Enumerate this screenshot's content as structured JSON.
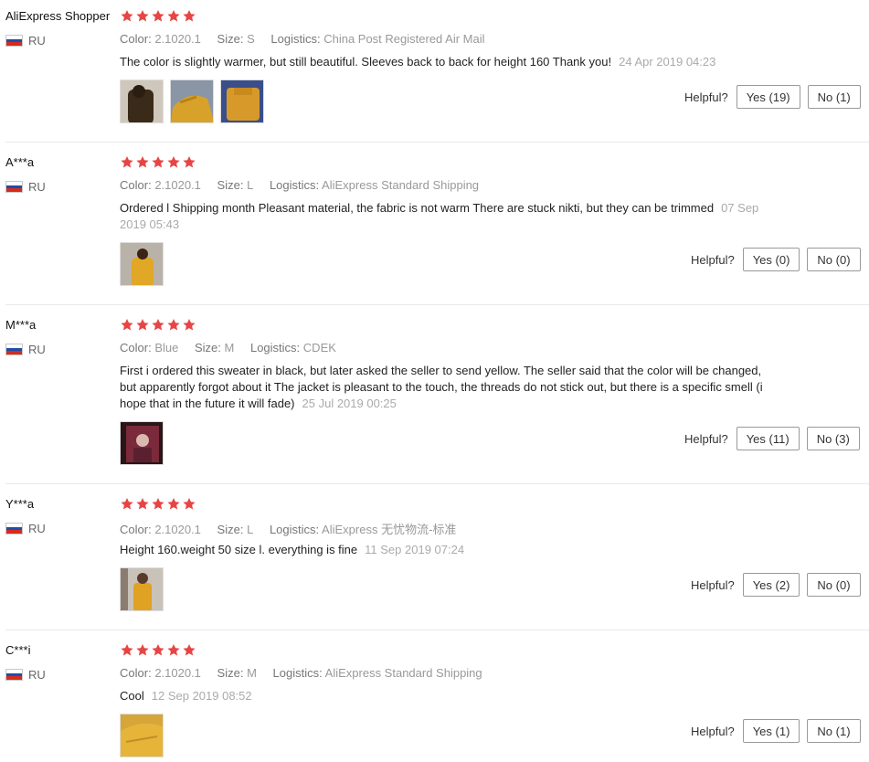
{
  "labels": {
    "color": "Color:",
    "size": "Size:",
    "logistics": "Logistics:",
    "helpful": "Helpful?"
  },
  "star_color": "#e64545",
  "reviews": [
    {
      "user": "AliExpress Shopper",
      "country": "RU",
      "rating": 5,
      "color": "2.1020.1",
      "size": "S",
      "logistics": "China Post Registered Air Mail",
      "text": "The color is slightly warmer, but still beautiful. Sleeves back to back for height 160 Thank you!",
      "date": "24 Apr 2019 04:23",
      "yes": "Yes (19)",
      "no": "No (1)"
    },
    {
      "user": "A***a",
      "country": "RU",
      "rating": 5,
      "color": "2.1020.1",
      "size": "L",
      "logistics": "AliExpress Standard Shipping",
      "text": "Ordered l Shipping month Pleasant material, the fabric is not warm There are stuck nikti, but they can be trimmed",
      "date": "07 Sep 2019 05:43",
      "yes": "Yes (0)",
      "no": "No (0)"
    },
    {
      "user": "M***a",
      "country": "RU",
      "rating": 5,
      "color": "Blue",
      "size": "M",
      "logistics": "CDEK",
      "text": "First i ordered this sweater in black, but later asked the seller to send yellow. The seller said that the color will be changed, but apparently forgot about it The jacket is pleasant to the touch, the threads do not stick out, but there is a specific smell (i hope that in the future it will fade)",
      "date": "25 Jul 2019 00:25",
      "yes": "Yes (11)",
      "no": "No (3)"
    },
    {
      "user": "Y***a",
      "country": "RU",
      "rating": 5,
      "color": "2.1020.1",
      "size": "L",
      "logistics": "AliExpress 无忧物流-标准",
      "text": "Height 160.weight 50 size l. everything is fine",
      "date": "11 Sep 2019 07:24",
      "yes": "Yes (2)",
      "no": "No (0)"
    },
    {
      "user": "C***i",
      "country": "RU",
      "rating": 5,
      "color": "2.1020.1",
      "size": "M",
      "logistics": "AliExpress Standard Shipping",
      "text": "Cool",
      "date": "12 Sep 2019 08:52",
      "yes": "Yes (1)",
      "no": "No (1)"
    }
  ]
}
